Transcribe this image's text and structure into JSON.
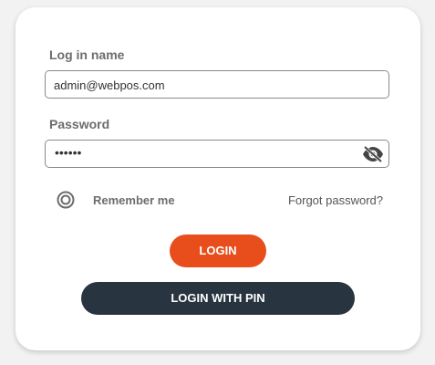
{
  "login_form": {
    "username_label": "Log in name",
    "username_value": "admin@webpos.com",
    "password_label": "Password",
    "password_value": "••••••",
    "remember_label": "Remember me",
    "remember_checked": true,
    "forgot_label": "Forgot password?",
    "login_button": "LOGIN",
    "pin_button": "LOGIN WITH PIN"
  },
  "icons": {
    "password_toggle": "eye-slash-icon",
    "remember": "radio-checked-icon"
  },
  "colors": {
    "primary": "#e84d1c",
    "secondary": "#283540",
    "label": "#6d6d6d"
  }
}
